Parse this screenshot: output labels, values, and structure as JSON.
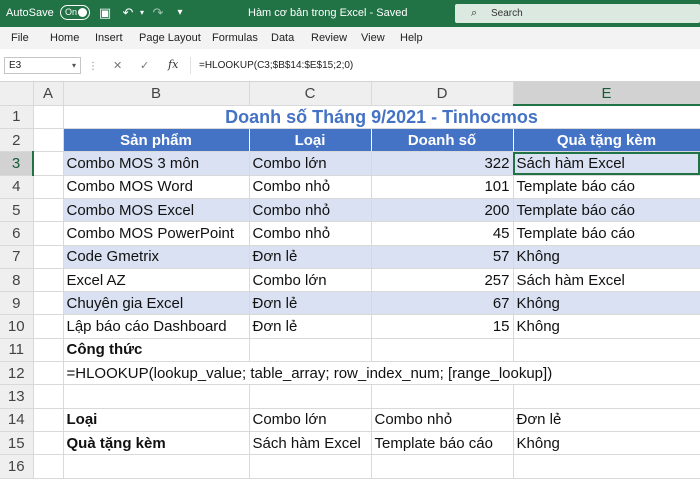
{
  "titlebar": {
    "autosave_label": "AutoSave",
    "autosave_state": "On",
    "doc_title": "Hàm cơ bản trong Excel  -  Saved",
    "search_placeholder": "Search"
  },
  "menu": [
    "File",
    "Home",
    "Insert",
    "Page Layout",
    "Formulas",
    "Data",
    "Review",
    "View",
    "Help"
  ],
  "formula_bar": {
    "name_box": "E3",
    "formula": "=HLOOKUP(C3;$B$14:$E$15;2;0)"
  },
  "columns": [
    "A",
    "B",
    "C",
    "D",
    "E"
  ],
  "rows": [
    "1",
    "2",
    "3",
    "4",
    "5",
    "6",
    "7",
    "8",
    "9",
    "10",
    "11",
    "12",
    "13",
    "14",
    "15",
    "16"
  ],
  "sheet": {
    "title": "Doanh số Tháng 9/2021 - Tinhocmos",
    "headers": [
      "Sản phẩm",
      "Loại",
      "Doanh số",
      "Quà tặng kèm"
    ],
    "data": [
      [
        "Combo MOS 3 môn",
        "Combo lớn",
        "322",
        "Sách hàm Excel"
      ],
      [
        "Combo MOS Word",
        "Combo nhỏ",
        "101",
        "Template báo cáo"
      ],
      [
        "Combo MOS Excel",
        "Combo nhỏ",
        "200",
        "Template báo cáo"
      ],
      [
        "Combo MOS PowerPoint",
        "Combo nhỏ",
        "45",
        "Template báo cáo"
      ],
      [
        "Code Gmetrix",
        "Đơn lẻ",
        "57",
        "Không"
      ],
      [
        "Excel AZ",
        "Combo lớn",
        "257",
        "Sách hàm Excel"
      ],
      [
        "Chuyên gia Excel",
        "Đơn lẻ",
        "67",
        "Không"
      ],
      [
        "Lập báo cáo Dashboard",
        "Đơn lẻ",
        "15",
        "Không"
      ]
    ],
    "formula_label": "Công thức",
    "formula_syntax": "=HLOOKUP(lookup_value; table_array; row_index_num; [range_lookup])",
    "lookup": {
      "row14": [
        "Loại",
        "Combo lớn",
        "Combo nhỏ",
        "Đơn lẻ"
      ],
      "row15": [
        "Quà tặng kèm",
        "Sách hàm Excel",
        "Template báo cáo",
        "Không"
      ]
    }
  },
  "colors": {
    "excel_green": "#217346",
    "header_blue": "#4472c4",
    "band_blue": "#d9e1f2"
  }
}
